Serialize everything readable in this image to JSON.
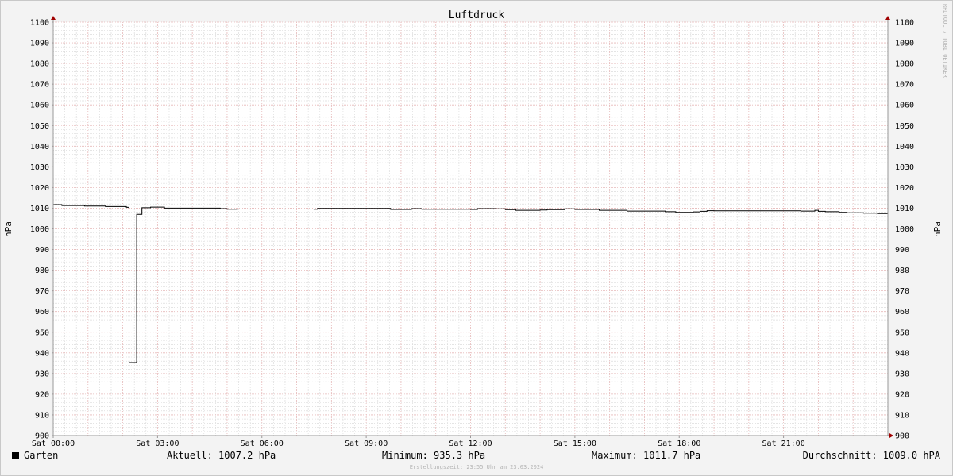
{
  "chart_data": {
    "type": "line",
    "title": "Luftdruck",
    "ylabel": "hPa",
    "ylabel_right": "hPa",
    "ylim": [
      900,
      1100
    ],
    "y_ticks": [
      900,
      910,
      920,
      930,
      940,
      950,
      960,
      970,
      980,
      990,
      1000,
      1010,
      1020,
      1030,
      1040,
      1050,
      1060,
      1070,
      1080,
      1090,
      1100
    ],
    "x_unit": "hours",
    "xlim": [
      0,
      24
    ],
    "x_ticks": [
      {
        "x": 0,
        "label": "Sat 00:00"
      },
      {
        "x": 3,
        "label": "Sat 03:00"
      },
      {
        "x": 6,
        "label": "Sat 06:00"
      },
      {
        "x": 9,
        "label": "Sat 09:00"
      },
      {
        "x": 12,
        "label": "Sat 12:00"
      },
      {
        "x": 15,
        "label": "Sat 15:00"
      },
      {
        "x": 18,
        "label": "Sat 18:00"
      },
      {
        "x": 21,
        "label": "Sat 21:00"
      }
    ],
    "grid": true,
    "series": [
      {
        "name": "Garten",
        "color": "#000000",
        "x": [
          0.0,
          0.25,
          0.9,
          1.5,
          2.1,
          2.12,
          2.18,
          2.35,
          2.4,
          2.55,
          2.8,
          3.2,
          4.8,
          5.0,
          5.3,
          7.5,
          7.6,
          9.7,
          10.3,
          10.6,
          11.0,
          12.0,
          12.2,
          12.7,
          13.0,
          13.3,
          13.8,
          14.0,
          14.2,
          14.7,
          15.0,
          15.7,
          16.5,
          17.6,
          17.9,
          18.4,
          18.6,
          18.8,
          19.0,
          21.5,
          21.9,
          22.0,
          22.2,
          22.6,
          22.8,
          23.3,
          23.7,
          24.0
        ],
        "y": [
          1011.7,
          1011.3,
          1011.0,
          1010.8,
          1010.5,
          1010.4,
          935.3,
          935.3,
          1007.0,
          1010.2,
          1010.5,
          1010.0,
          1009.8,
          1009.5,
          1009.6,
          1009.5,
          1009.9,
          1009.4,
          1009.8,
          1009.5,
          1009.5,
          1009.4,
          1009.8,
          1009.7,
          1009.3,
          1009.0,
          1009.0,
          1009.1,
          1009.3,
          1009.7,
          1009.4,
          1009.0,
          1008.6,
          1008.3,
          1008.0,
          1008.2,
          1008.5,
          1008.8,
          1008.7,
          1008.6,
          1009.0,
          1008.5,
          1008.3,
          1008.0,
          1007.8,
          1007.6,
          1007.4,
          1007.2
        ]
      }
    ],
    "legend_placement": "bottom-left"
  },
  "legend": {
    "series_name": "Garten",
    "current": "Aktuell: 1007.2 hPa",
    "minimum": "Minimum: 935.3 hPa",
    "maximum": "Maximum: 1011.7 hPa",
    "average": "Durchschnitt: 1009.0 hPA"
  },
  "credit": "RRDTOOL / TOBI OETIKER",
  "footer": "Erstellungszeit: 23:55 Uhr am 23.03.2024"
}
